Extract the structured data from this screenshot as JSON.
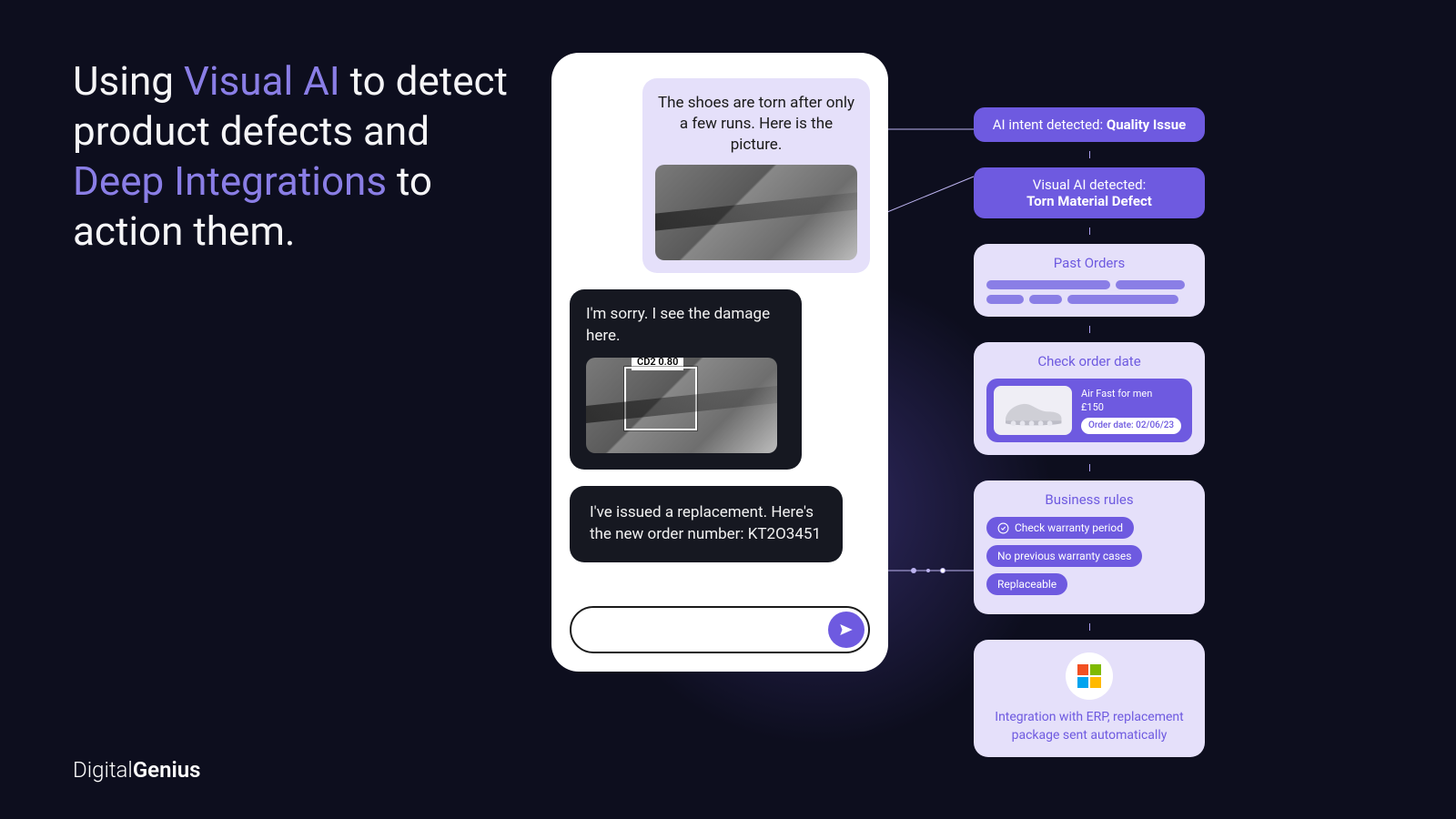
{
  "headline": {
    "part1": "Using ",
    "accent1": "Visual AI",
    "part2": " to detect product defects and ",
    "accent2": "Deep Integrations",
    "part3": " to action them."
  },
  "brand": {
    "light": "Digital",
    "bold": "Genius"
  },
  "chat": {
    "user_msg": "The shoes are torn after only a few runs. Here is the picture.",
    "agent_msg1": "I'm sorry. I see the damage here.",
    "detection_label": "CD2 0.80",
    "agent_msg2": "I've issued a replacement. Here's the new order number: KT2O3451"
  },
  "right": {
    "intent_prefix": "AI intent detected: ",
    "intent_value": "Quality Issue",
    "visual_line1": "Visual AI detected:",
    "visual_line2": "Torn Material Defect",
    "past_orders_title": "Past Orders",
    "check_order_title": "Check order date",
    "product_name": "Air Fast for men",
    "product_price": "£150",
    "order_date_label": "Order date: 02/06/23",
    "business_rules_title": "Business rules",
    "rule1": "Check warranty period",
    "rule2": "No previous warranty cases",
    "rule3": "Replaceable",
    "erp_text": "Integration with ERP, replacement package sent automatically"
  }
}
